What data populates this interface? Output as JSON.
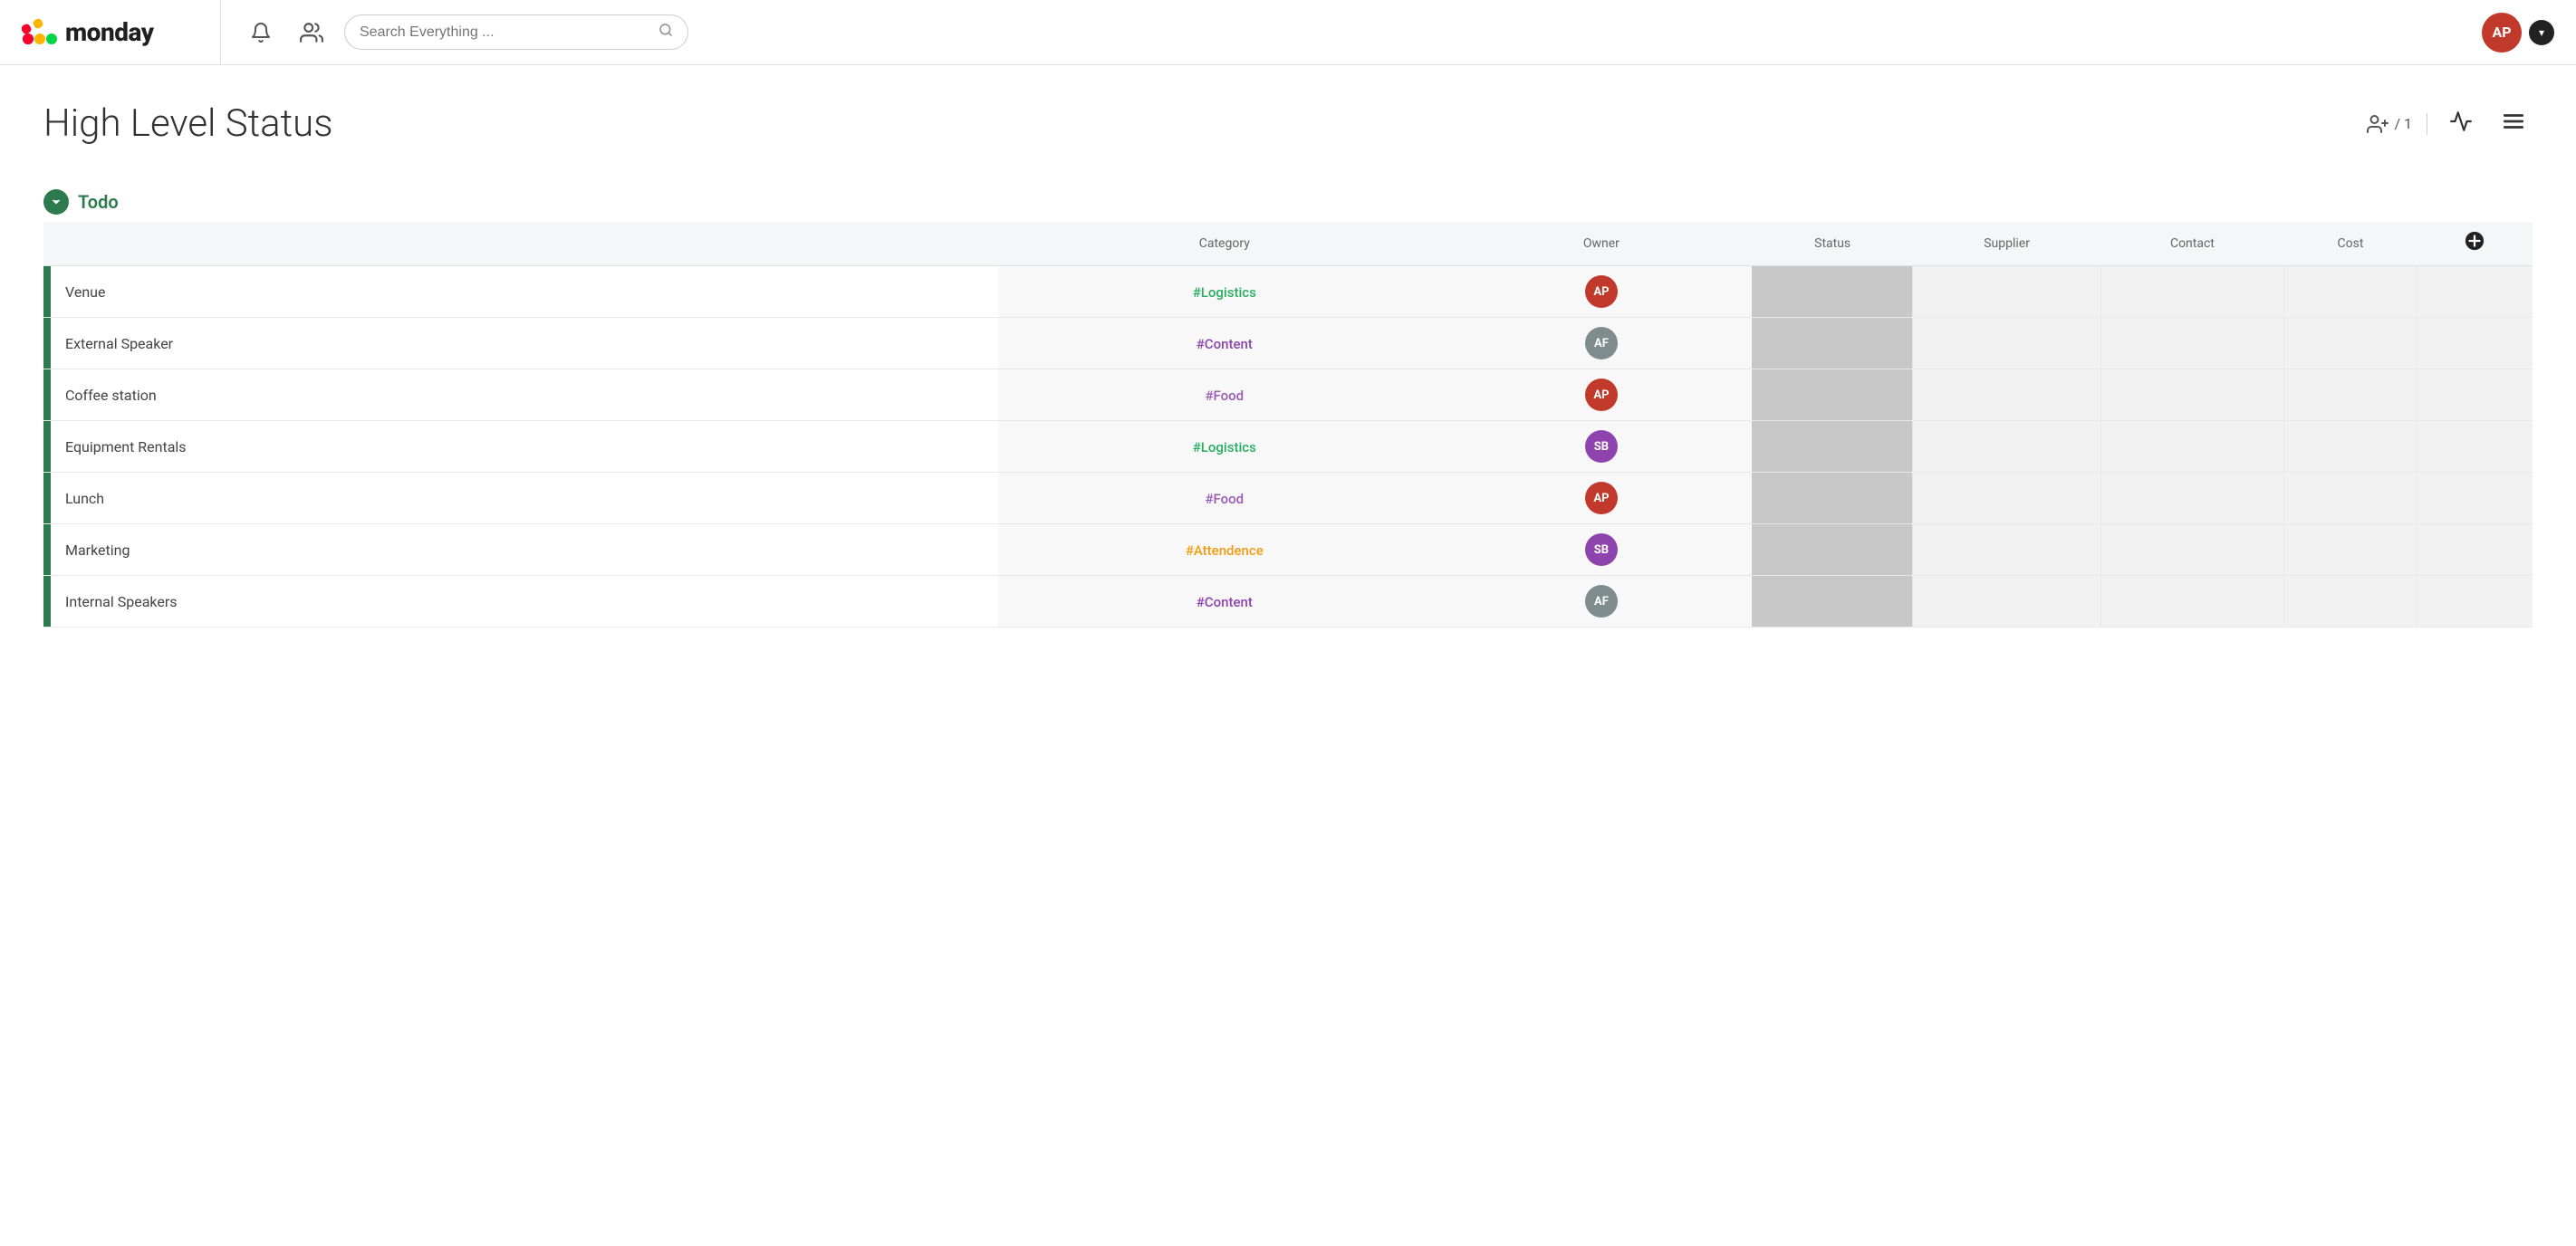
{
  "header": {
    "logo_text": "monday",
    "search_placeholder": "Search Everything ...",
    "user_initials": "AP",
    "dropdown_arrow": "▾"
  },
  "page": {
    "title": "High Level Status",
    "invitee_count": "/ 1"
  },
  "group": {
    "label": "Todo",
    "chevron": "▼"
  },
  "columns": {
    "name": "",
    "category": "Category",
    "owner": "Owner",
    "status": "Status",
    "supplier": "Supplier",
    "contact": "Contact",
    "cost": "Cost"
  },
  "rows": [
    {
      "name": "Venue",
      "category": "#Logistics",
      "category_class": "cat-logistics",
      "owner_initials": "AP",
      "owner_class": "av-ap"
    },
    {
      "name": "External Speaker",
      "category": "#Content",
      "category_class": "cat-content",
      "owner_initials": "AF",
      "owner_class": "av-af"
    },
    {
      "name": "Coffee station",
      "category": "#Food",
      "category_class": "cat-food",
      "owner_initials": "AP",
      "owner_class": "av-ap"
    },
    {
      "name": "Equipment Rentals",
      "category": "#Logistics",
      "category_class": "cat-logistics",
      "owner_initials": "SB",
      "owner_class": "av-sb"
    },
    {
      "name": "Lunch",
      "category": "#Food",
      "category_class": "cat-food",
      "owner_initials": "AP",
      "owner_class": "av-ap"
    },
    {
      "name": "Marketing",
      "category": "#Attendence",
      "category_class": "cat-attendence",
      "owner_initials": "SB",
      "owner_class": "av-sb"
    },
    {
      "name": "Internal Speakers",
      "category": "#Content",
      "category_class": "cat-content",
      "owner_initials": "AF",
      "owner_class": "av-af"
    }
  ]
}
